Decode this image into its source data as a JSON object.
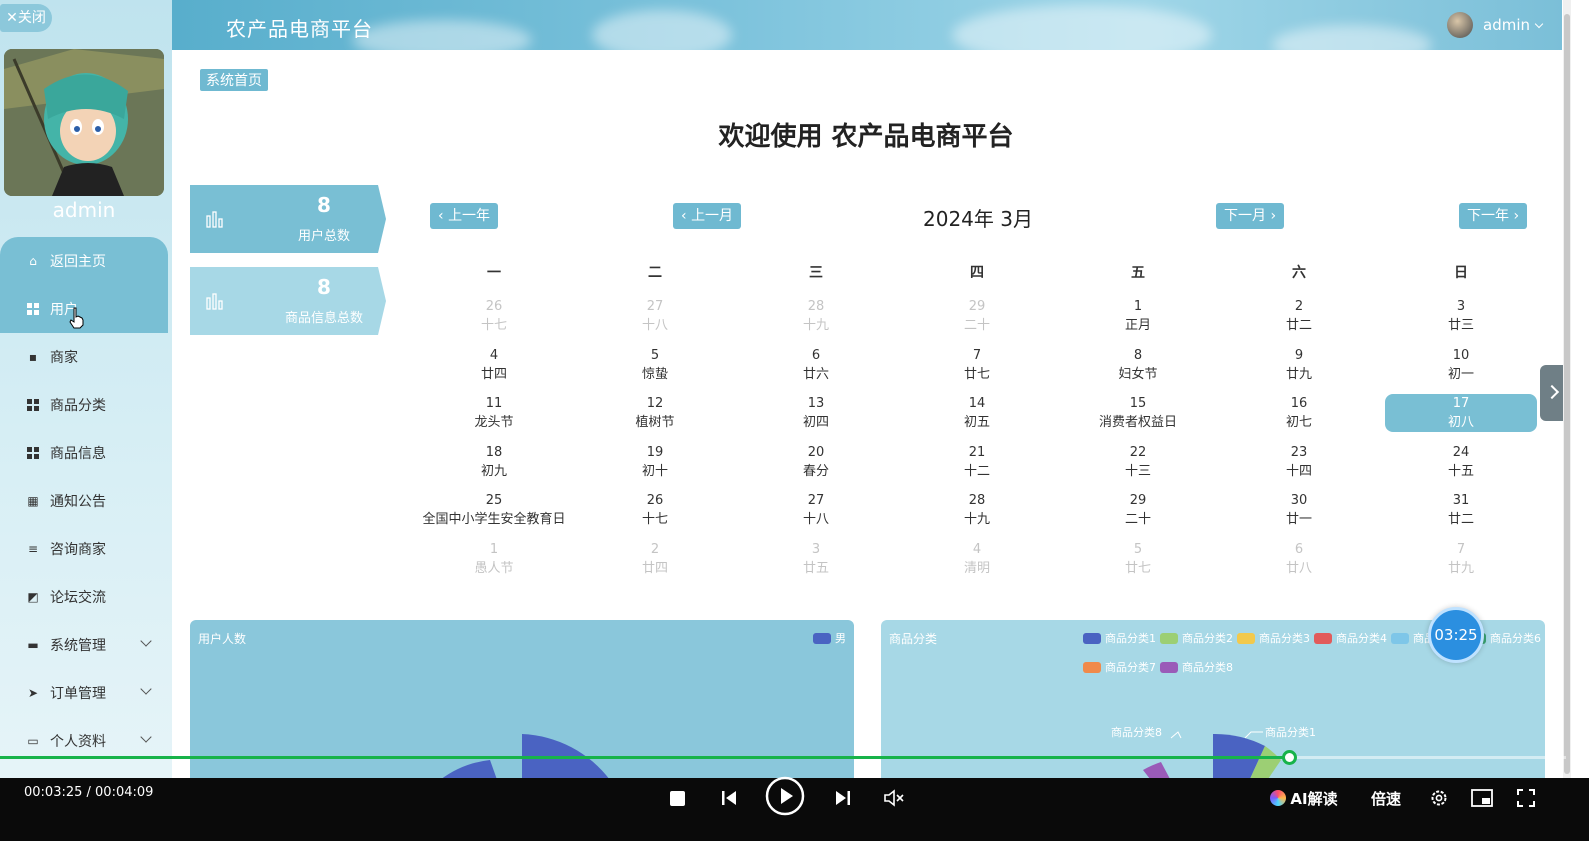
{
  "sidebar": {
    "close_label": "关闭",
    "username": "admin",
    "menu": [
      {
        "label": "返回主页",
        "icon": "home-icon"
      },
      {
        "label": "用户",
        "icon": "grid-icon"
      },
      {
        "label": "商家",
        "icon": "clipboard-icon"
      },
      {
        "label": "商品分类",
        "icon": "grid-icon"
      },
      {
        "label": "商品信息",
        "icon": "grid-icon"
      },
      {
        "label": "通知公告",
        "icon": "grid9-icon"
      },
      {
        "label": "咨询商家",
        "icon": "list-icon"
      },
      {
        "label": "论坛交流",
        "icon": "chart-icon"
      },
      {
        "label": "系统管理",
        "icon": "chat-icon"
      },
      {
        "label": "订单管理",
        "icon": "send-icon"
      },
      {
        "label": "个人资料",
        "icon": "card-icon"
      }
    ]
  },
  "header": {
    "title": "农产品电商平台",
    "user": "admin"
  },
  "breadcrumb": "系统首页",
  "welcome": "欢迎使用 农产品电商平台",
  "stats": [
    {
      "value": "8",
      "label": "用户总数",
      "color": "#79bfd4"
    },
    {
      "value": "8",
      "label": "商品信息总数",
      "color": "#a7d8e6"
    }
  ],
  "calendar": {
    "prev_year": "上一年",
    "prev_month": "上一月",
    "title": "2024年 3月",
    "next_month": "下一月",
    "next_year": "下一年",
    "weekdays": [
      "一",
      "二",
      "三",
      "四",
      "五",
      "六",
      "日"
    ],
    "weeks": [
      [
        [
          "26",
          "十七",
          true
        ],
        [
          "27",
          "十八",
          true
        ],
        [
          "28",
          "十九",
          true
        ],
        [
          "29",
          "二十",
          true
        ],
        [
          "1",
          "正月",
          false
        ],
        [
          "2",
          "廿二",
          false
        ],
        [
          "3",
          "廿三",
          false
        ]
      ],
      [
        [
          "4",
          "廿四",
          false
        ],
        [
          "5",
          "惊蛰",
          false
        ],
        [
          "6",
          "廿六",
          false
        ],
        [
          "7",
          "廿七",
          false
        ],
        [
          "8",
          "妇女节",
          false
        ],
        [
          "9",
          "廿九",
          false
        ],
        [
          "10",
          "初一",
          false
        ]
      ],
      [
        [
          "11",
          "龙头节",
          false
        ],
        [
          "12",
          "植树节",
          false
        ],
        [
          "13",
          "初四",
          false
        ],
        [
          "14",
          "初五",
          false
        ],
        [
          "15",
          "消费者权益日",
          false
        ],
        [
          "16",
          "初七",
          false
        ],
        [
          "17",
          "初八",
          false
        ]
      ],
      [
        [
          "18",
          "初九",
          false
        ],
        [
          "19",
          "初十",
          false
        ],
        [
          "20",
          "春分",
          false
        ],
        [
          "21",
          "十二",
          false
        ],
        [
          "22",
          "十三",
          false
        ],
        [
          "23",
          "十四",
          false
        ],
        [
          "24",
          "十五",
          false
        ]
      ],
      [
        [
          "25",
          "全国中小学生安全教育日",
          false
        ],
        [
          "26",
          "十七",
          false
        ],
        [
          "27",
          "十八",
          false
        ],
        [
          "28",
          "十九",
          false
        ],
        [
          "29",
          "二十",
          false
        ],
        [
          "30",
          "廿一",
          false
        ],
        [
          "31",
          "廿二",
          false
        ]
      ],
      [
        [
          "1",
          "愚人节",
          true
        ],
        [
          "2",
          "廿四",
          true
        ],
        [
          "3",
          "廿五",
          true
        ],
        [
          "4",
          "清明",
          true
        ],
        [
          "5",
          "廿七",
          true
        ],
        [
          "6",
          "廿八",
          true
        ],
        [
          "7",
          "廿九",
          true
        ]
      ]
    ],
    "today": "17"
  },
  "charts": {
    "users": {
      "title": "用户人数",
      "legend": [
        {
          "name": "男",
          "color": "#4a63c2"
        }
      ]
    },
    "categories": {
      "title": "商品分类",
      "legend": [
        {
          "name": "商品分类1",
          "color": "#4a63c2"
        },
        {
          "name": "商品分类2",
          "color": "#9ccf74"
        },
        {
          "name": "商品分类3",
          "color": "#f2c94c"
        },
        {
          "name": "商品分类4",
          "color": "#e25b5b"
        },
        {
          "name": "商品分类5",
          "color": "#7ec6e8"
        },
        {
          "name": "商品分类6",
          "color": "#3aa272"
        },
        {
          "name": "商品分类7",
          "color": "#f08a4b"
        },
        {
          "name": "商品分类8",
          "color": "#9a5bb8"
        }
      ],
      "labels": [
        "商品分类8",
        "商品分类1"
      ]
    }
  },
  "timer": "03:25",
  "player": {
    "time": "00:03:25 / 00:04:09",
    "progress": 0.823,
    "ai_label": "AI解读",
    "speed_label": "倍速"
  }
}
